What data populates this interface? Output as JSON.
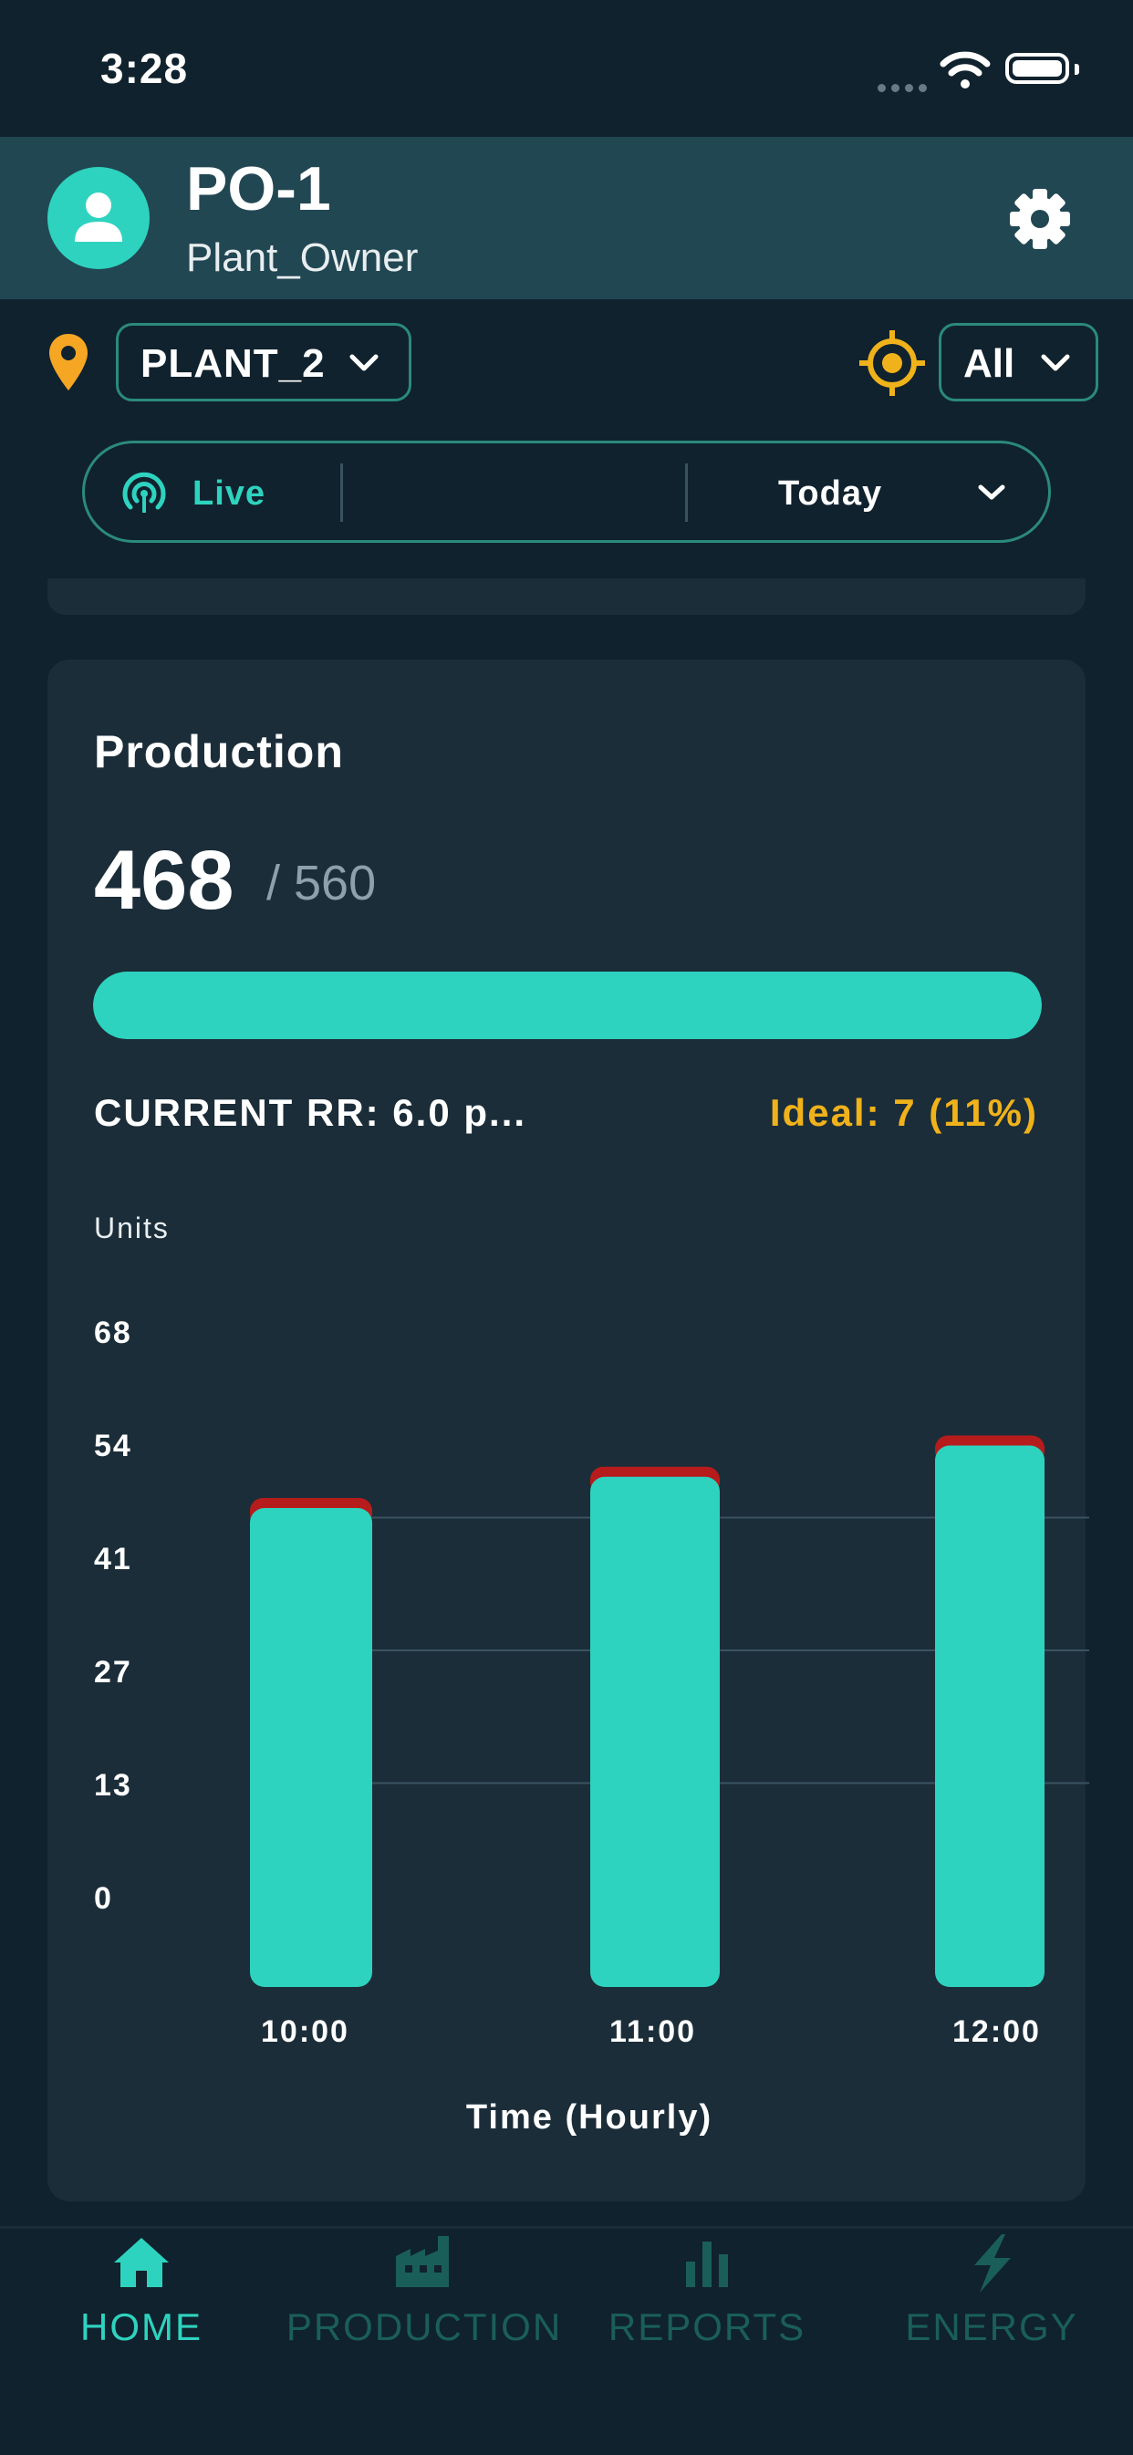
{
  "status_bar": {
    "time": "3:28"
  },
  "header": {
    "user_name": "PO-1",
    "user_role": "Plant_Owner"
  },
  "filters": {
    "plant": "PLANT_2",
    "scope": "All"
  },
  "time_range": {
    "mode": "Live",
    "range": "Today"
  },
  "production": {
    "title": "Production",
    "value": "468",
    "target": "/ 560",
    "progress_fraction": 1.0,
    "current_rr": "CURRENT RR: 6.0 p...",
    "ideal": "Ideal: 7 (11%)"
  },
  "chart_data": {
    "type": "bar",
    "ylabel": "Units",
    "xlabel": "Time (Hourly)",
    "y_ticks": [
      "68",
      "54",
      "41",
      "27",
      "13",
      "0"
    ],
    "ylim": [
      0,
      68
    ],
    "categories": [
      "10:00",
      "11:00",
      "12:00"
    ],
    "series": [
      {
        "values": [
          46,
          49,
          52
        ]
      },
      {
        "values": [
          1,
          1,
          1
        ]
      }
    ],
    "colors": {
      "good": "#2ed3bf",
      "rejected": "#b71c1c"
    }
  },
  "bottom_nav": {
    "items": [
      {
        "label": "HOME",
        "icon": "home-icon",
        "active": true
      },
      {
        "label": "PRODUCTION",
        "icon": "factory-icon",
        "active": false
      },
      {
        "label": "REPORTS",
        "icon": "bar-chart-icon",
        "active": false
      },
      {
        "label": "ENERGY",
        "icon": "lightning-icon",
        "active": false
      }
    ]
  },
  "colors": {
    "accent": "#2ed3bf",
    "warning": "#f0b21a",
    "background": "#10222d",
    "card": "#1b2d39",
    "header": "#214753"
  }
}
